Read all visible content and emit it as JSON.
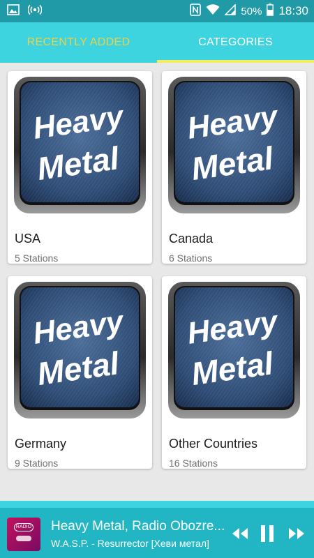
{
  "status_bar": {
    "battery_percent": "50%",
    "time": "18:30",
    "icons": [
      "image-icon",
      "radio-broadcast-icon",
      "nfc-icon",
      "wifi-icon",
      "signal-icon",
      "battery-icon"
    ]
  },
  "tabs": [
    {
      "label": "RECENTLY ADDED",
      "selected": false
    },
    {
      "label": "CATEGORIES",
      "selected": true
    }
  ],
  "colors": {
    "status_bar": "#1f9aa6",
    "tab_bar": "#3dd3df",
    "tab_inactive_text": "#e8d34a",
    "tab_indicator": "#f4ec5b",
    "player_bar": "#22b6c4"
  },
  "artwork_text": {
    "line1": "Heavy",
    "line2": "Metal"
  },
  "categories": [
    {
      "name": "USA",
      "count": "5 Stations"
    },
    {
      "name": "Canada",
      "count": "6 Stations"
    },
    {
      "name": "Germany",
      "count": "9 Stations"
    },
    {
      "name": "Other Countries",
      "count": "16 Stations"
    }
  ],
  "player": {
    "thumb_badge": "RADIO",
    "title": "Heavy Metal, Radio Obozre...",
    "subtitle": "W.A.S.P. - Resurrector [Хеви метал]",
    "controls": [
      "previous-icon",
      "pause-icon",
      "next-icon"
    ]
  }
}
